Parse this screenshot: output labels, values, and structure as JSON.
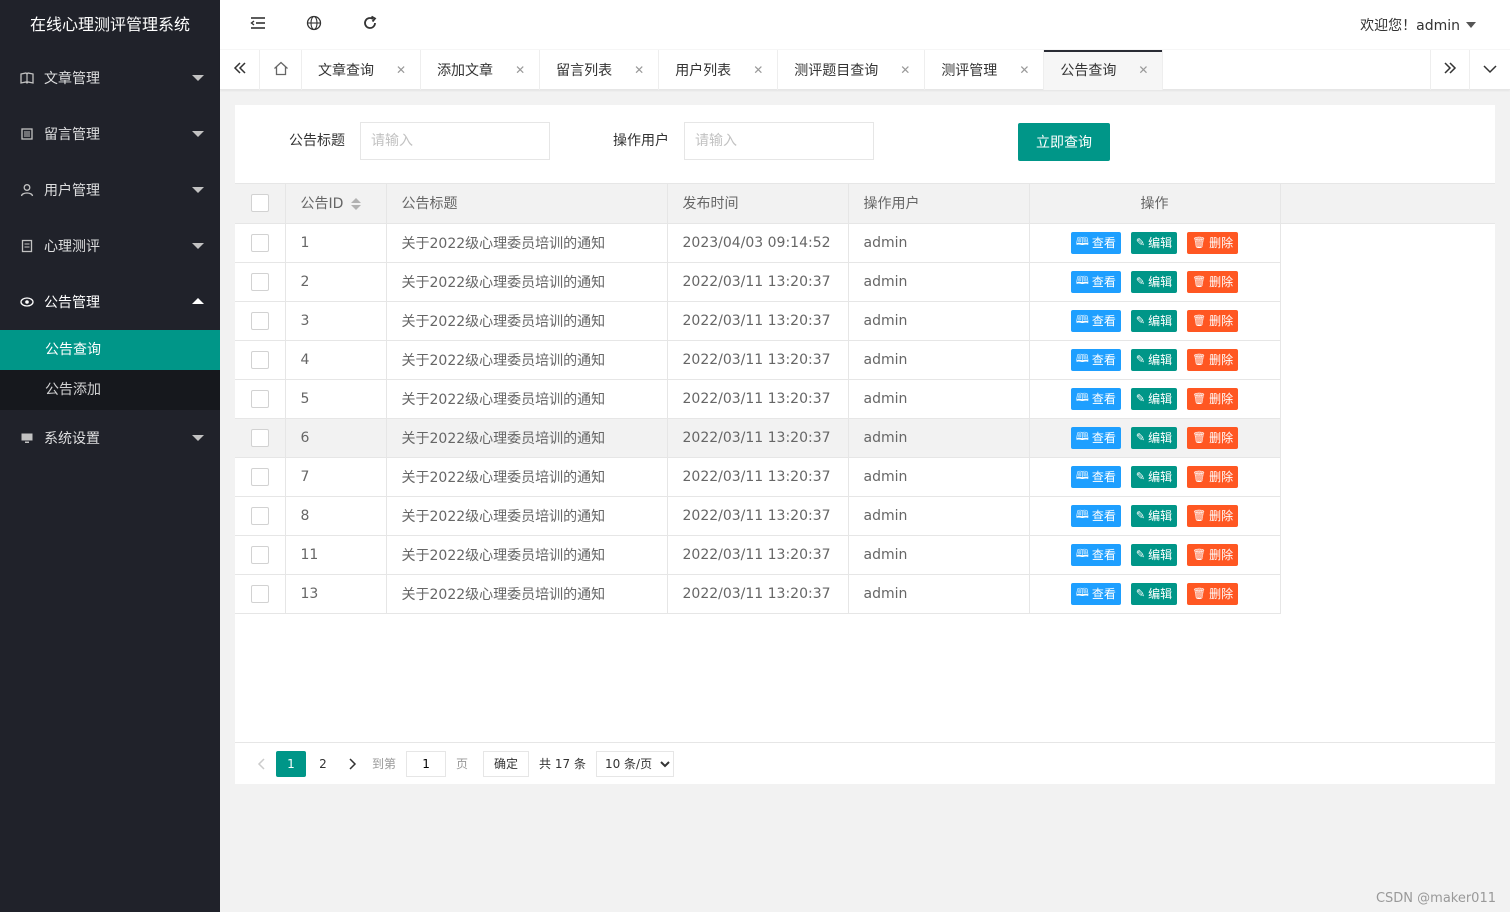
{
  "app_title": "在线心理测评管理系统",
  "sidebar": {
    "items": [
      {
        "label": "文章管理",
        "icon": "book-icon"
      },
      {
        "label": "留言管理",
        "icon": "list-icon"
      },
      {
        "label": "用户管理",
        "icon": "user-icon"
      },
      {
        "label": "心理测评",
        "icon": "document-icon"
      },
      {
        "label": "公告管理",
        "icon": "eye-icon"
      },
      {
        "label": "系统设置",
        "icon": "monitor-icon"
      }
    ],
    "submenu": [
      {
        "label": "公告查询"
      },
      {
        "label": "公告添加"
      }
    ]
  },
  "header": {
    "user_label": "欢迎您！admin"
  },
  "tabs": [
    {
      "label": "文章查询"
    },
    {
      "label": "添加文章"
    },
    {
      "label": "留言列表"
    },
    {
      "label": "用户列表"
    },
    {
      "label": "测评题目查询"
    },
    {
      "label": "测评管理"
    },
    {
      "label": "公告查询"
    }
  ],
  "search": {
    "title_label": "公告标题",
    "title_placeholder": "请输入",
    "user_label": "操作用户",
    "user_placeholder": "请输入",
    "button_label": "立即查询"
  },
  "table": {
    "headers": {
      "id": "公告ID",
      "title": "公告标题",
      "time": "发布时间",
      "user": "操作用户",
      "ops": "操作"
    },
    "actions": {
      "view": "查看",
      "edit": "编辑",
      "delete": "删除"
    },
    "rows": [
      {
        "id": "1",
        "title": "关于2022级心理委员培训的通知",
        "time": "2023/04/03 09:14:52",
        "user": "admin"
      },
      {
        "id": "2",
        "title": "关于2022级心理委员培训的通知",
        "time": "2022/03/11 13:20:37",
        "user": "admin"
      },
      {
        "id": "3",
        "title": "关于2022级心理委员培训的通知",
        "time": "2022/03/11 13:20:37",
        "user": "admin"
      },
      {
        "id": "4",
        "title": "关于2022级心理委员培训的通知",
        "time": "2022/03/11 13:20:37",
        "user": "admin"
      },
      {
        "id": "5",
        "title": "关于2022级心理委员培训的通知",
        "time": "2022/03/11 13:20:37",
        "user": "admin"
      },
      {
        "id": "6",
        "title": "关于2022级心理委员培训的通知",
        "time": "2022/03/11 13:20:37",
        "user": "admin"
      },
      {
        "id": "7",
        "title": "关于2022级心理委员培训的通知",
        "time": "2022/03/11 13:20:37",
        "user": "admin"
      },
      {
        "id": "8",
        "title": "关于2022级心理委员培训的通知",
        "time": "2022/03/11 13:20:37",
        "user": "admin"
      },
      {
        "id": "11",
        "title": "关于2022级心理委员培训的通知",
        "time": "2022/03/11 13:20:37",
        "user": "admin"
      },
      {
        "id": "13",
        "title": "关于2022级心理委员培训的通知",
        "time": "2022/03/11 13:20:37",
        "user": "admin"
      }
    ]
  },
  "pager": {
    "pages": [
      "1",
      "2"
    ],
    "goto_prefix": "到第",
    "goto_value": "1",
    "goto_suffix": "页",
    "confirm_label": "确定",
    "total_label": "共 17 条",
    "page_size": "10 条/页"
  },
  "watermark": "CSDN @maker011",
  "colors": {
    "accent": "#009688",
    "view": "#1e9fff",
    "delete": "#ff5722",
    "sidebar": "#20222a"
  }
}
